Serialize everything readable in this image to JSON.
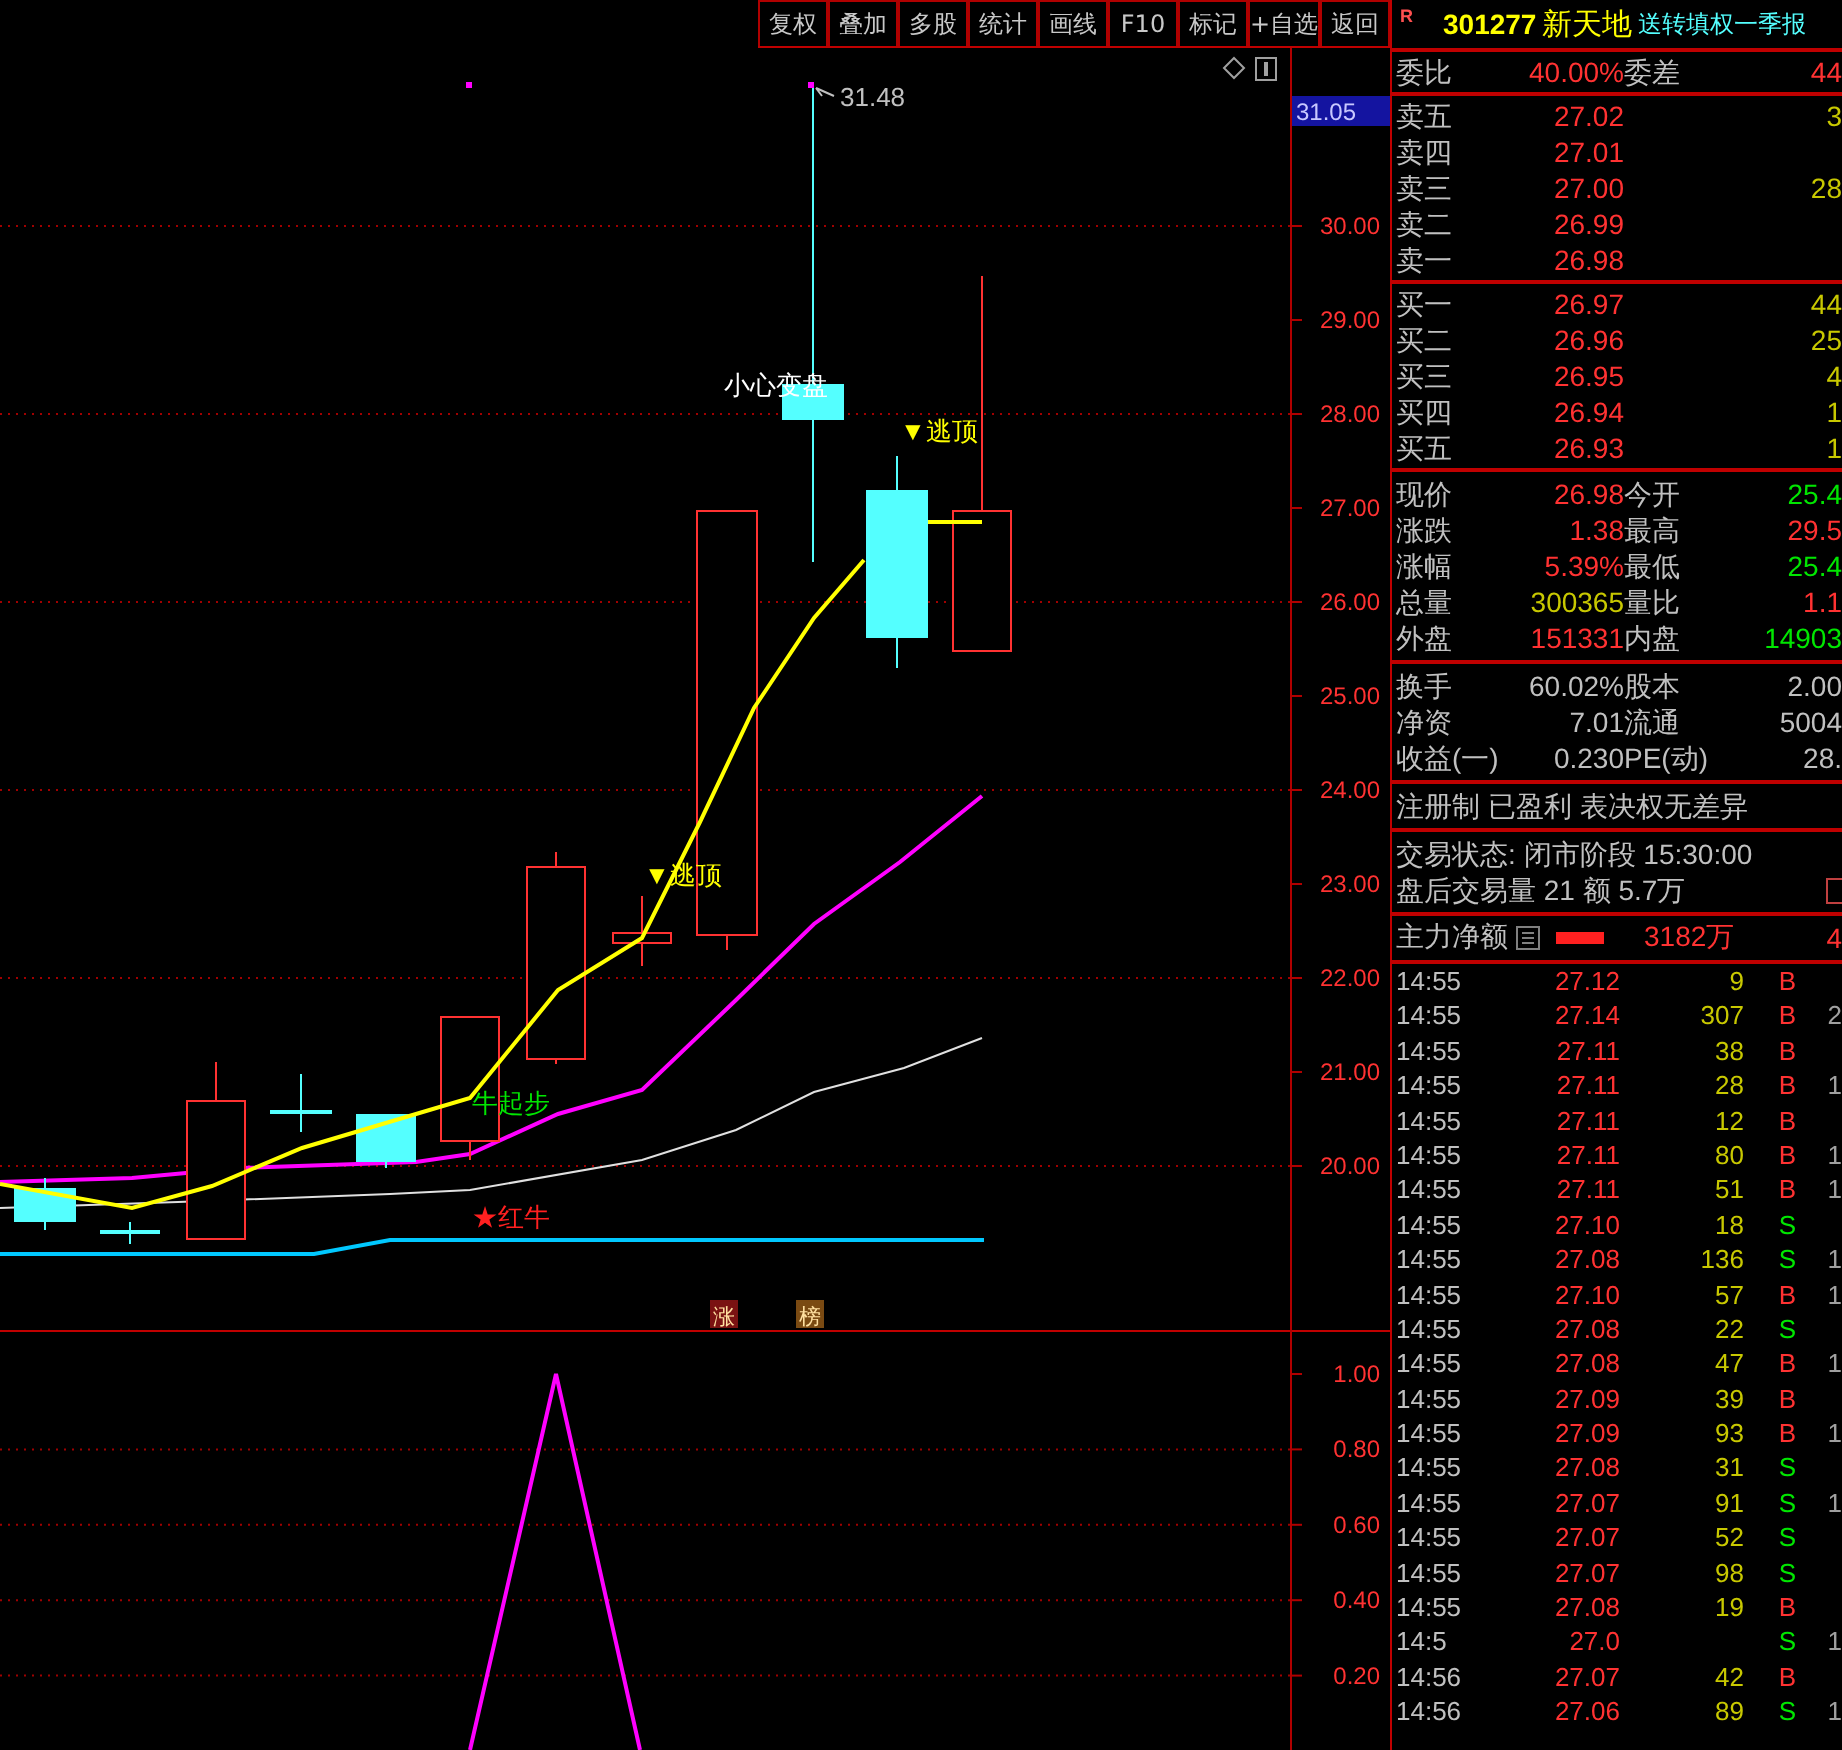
{
  "toolbar": {
    "buttons": [
      "复权",
      "叠加",
      "多股",
      "统计",
      "画线",
      "F10",
      "标记",
      "+自选",
      "返回"
    ]
  },
  "main_chart": {
    "price_axis": [
      "30.00",
      "29.00",
      "28.00",
      "27.00",
      "26.00",
      "25.00",
      "24.00",
      "23.00",
      "22.00",
      "21.00",
      "20.00"
    ],
    "last_price": "31.05",
    "annotations": [
      {
        "kind": "high",
        "text": "31.48"
      },
      {
        "kind": "warning",
        "text": "小心变盘"
      },
      {
        "kind": "top",
        "text": "▼逃顶"
      },
      {
        "kind": "top",
        "text": "▼逃顶"
      },
      {
        "kind": "start",
        "text": "牛起步"
      },
      {
        "kind": "signal",
        "text": "★红牛"
      }
    ],
    "badges": [
      {
        "text": "涨",
        "color": "#7a1212"
      },
      {
        "text": "榜",
        "color": "#7a4a12"
      }
    ]
  },
  "indicator_chart": {
    "axis_labels": [
      "1.00",
      "0.80",
      "0.60",
      "0.40",
      "0.20"
    ]
  },
  "quote": {
    "flag": "R",
    "code": "301277",
    "name": "新天地",
    "notice": "送转填权一季报",
    "ratio": {
      "label": "委比",
      "value": "40.00%",
      "label2": "委差",
      "value2": "44"
    },
    "asks": [
      {
        "label": "卖五",
        "price": "27.02",
        "volume": "3"
      },
      {
        "label": "卖四",
        "price": "27.01"
      },
      {
        "label": "卖三",
        "price": "27.00",
        "volume": "28"
      },
      {
        "label": "卖二",
        "price": "26.99"
      },
      {
        "label": "卖一",
        "price": "26.98"
      }
    ],
    "bids": [
      {
        "label": "买一",
        "price": "26.97",
        "volume": "44"
      },
      {
        "label": "买二",
        "price": "26.96",
        "volume": "25"
      },
      {
        "label": "买三",
        "price": "26.95",
        "volume": "4"
      },
      {
        "label": "买四",
        "price": "26.94",
        "volume": "1"
      },
      {
        "label": "买五",
        "price": "26.93",
        "volume": "1"
      }
    ],
    "stats": [
      [
        {
          "label": "现价",
          "value": "26.98",
          "color": "#ff3232"
        },
        {
          "label": "今开",
          "value": "25.4",
          "color": "#00e600"
        }
      ],
      [
        {
          "label": "涨跌",
          "value": "1.38",
          "color": "#ff3232"
        },
        {
          "label": "最高",
          "value": "29.5",
          "color": "#ff3232"
        }
      ],
      [
        {
          "label": "涨幅",
          "value": "5.39%",
          "color": "#ff3232"
        },
        {
          "label": "最低",
          "value": "25.4",
          "color": "#00e600"
        }
      ],
      [
        {
          "label": "总量",
          "value": "300365",
          "color": "#c8c800"
        },
        {
          "label": "量比",
          "value": "1.1",
          "color": "#ff3232"
        }
      ],
      [
        {
          "label": "外盘",
          "value": "151331",
          "color": "#ff3232"
        },
        {
          "label": "内盘",
          "value": "14903",
          "color": "#00e600"
        }
      ]
    ],
    "fundamentals": [
      {
        "label": "换手",
        "value": "60.02%",
        "label2": "股本",
        "value2": "2.00"
      },
      {
        "label": "净资",
        "value": "7.01",
        "label2": "流通",
        "value2": "5004"
      },
      {
        "label": "收益(一)",
        "value": "0.230",
        "label2": "PE(动)",
        "value2": "28."
      }
    ],
    "tags": "注册制 已盈利 表决权无差异",
    "trading_status": "交易状态: 闭市阶段 15:30:00",
    "after_hours": "盘后交易量 21 额 5.7万",
    "main_flow": {
      "label": "主力净额",
      "value": "3182万",
      "value2": "4"
    }
  },
  "trades": [
    {
      "time": "14:55",
      "price": "27.12",
      "volume": "9",
      "side": "B",
      "kind": "buy"
    },
    {
      "time": "14:55",
      "price": "27.14",
      "volume": "307",
      "side": "B",
      "kind": "buy",
      "extra": "2"
    },
    {
      "time": "14:55",
      "price": "27.11",
      "volume": "38",
      "side": "B",
      "kind": "buy"
    },
    {
      "time": "14:55",
      "price": "27.11",
      "volume": "28",
      "side": "B",
      "kind": "buy",
      "extra": "1"
    },
    {
      "time": "14:55",
      "price": "27.11",
      "volume": "12",
      "side": "B",
      "kind": "buy"
    },
    {
      "time": "14:55",
      "price": "27.11",
      "volume": "80",
      "side": "B",
      "kind": "buy",
      "extra": "1"
    },
    {
      "time": "14:55",
      "price": "27.11",
      "volume": "51",
      "side": "B",
      "kind": "buy",
      "extra": "1"
    },
    {
      "time": "14:55",
      "price": "27.10",
      "volume": "18",
      "side": "S",
      "kind": "sell"
    },
    {
      "time": "14:55",
      "price": "27.08",
      "volume": "136",
      "side": "S",
      "kind": "sell",
      "extra": "1"
    },
    {
      "time": "14:55",
      "price": "27.10",
      "volume": "57",
      "side": "B",
      "kind": "buy",
      "extra": "1"
    },
    {
      "time": "14:55",
      "price": "27.08",
      "volume": "22",
      "side": "S",
      "kind": "sell"
    },
    {
      "time": "14:55",
      "price": "27.08",
      "volume": "47",
      "side": "B",
      "kind": "buy",
      "extra": "1"
    },
    {
      "time": "14:55",
      "price": "27.09",
      "volume": "39",
      "side": "B",
      "kind": "buy"
    },
    {
      "time": "14:55",
      "price": "27.09",
      "volume": "93",
      "side": "B",
      "kind": "buy",
      "extra": "1"
    },
    {
      "time": "14:55",
      "price": "27.08",
      "volume": "31",
      "side": "S",
      "kind": "sell"
    },
    {
      "time": "14:55",
      "price": "27.07",
      "volume": "91",
      "side": "S",
      "kind": "sell",
      "extra": "1"
    },
    {
      "time": "14:55",
      "price": "27.07",
      "volume": "52",
      "side": "S",
      "kind": "sell"
    },
    {
      "time": "14:55",
      "price": "27.07",
      "volume": "98",
      "side": "S",
      "kind": "sell"
    },
    {
      "time": "14:55",
      "price": "27.08",
      "volume": "19",
      "side": "B",
      "kind": "buy"
    },
    {
      "time": "14:5",
      "price": "27.0",
      "side": "S",
      "kind": "sell",
      "extra": "1"
    },
    {
      "time": "14:56",
      "price": "27.07",
      "volume": "42",
      "side": "B",
      "kind": "buy"
    },
    {
      "time": "14:56",
      "price": "27.06",
      "volume": "89",
      "side": "S",
      "kind": "sell",
      "extra": "1"
    }
  ]
}
